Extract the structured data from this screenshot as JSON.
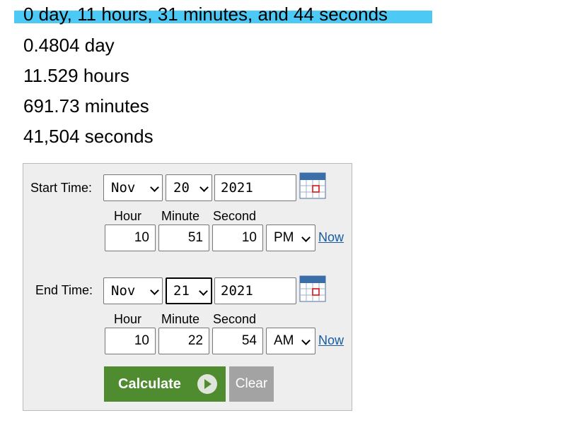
{
  "results": [
    "0 day, 11 hours, 31 minutes, and 44 seconds",
    "0.4804 day",
    "11.529 hours",
    "691.73 minutes",
    "41,504 seconds"
  ],
  "form": {
    "start": {
      "label": "Start Time:",
      "month": "Nov",
      "day": "20",
      "year": "2021",
      "hour_label": "Hour",
      "minute_label": "Minute",
      "second_label": "Second",
      "hour": "10",
      "minute": "51",
      "second": "10",
      "ampm": "PM",
      "now_label": "Now"
    },
    "end": {
      "label": "End Time:",
      "month": "Nov",
      "day": "21",
      "year": "2021",
      "hour_label": "Hour",
      "minute_label": "Minute",
      "second_label": "Second",
      "hour": "10",
      "minute": "22",
      "second": "54",
      "ampm": "AM",
      "now_label": "Now"
    },
    "calculate_label": "Calculate",
    "clear_label": "Clear"
  },
  "icons": {
    "calendar": "calendar-icon",
    "play": "play-icon"
  },
  "colors": {
    "highlight": "#4dc9f6",
    "calculate_bg": "#4f8b2f",
    "clear_bg": "#a3a3a3",
    "link": "#1a5aa0"
  }
}
